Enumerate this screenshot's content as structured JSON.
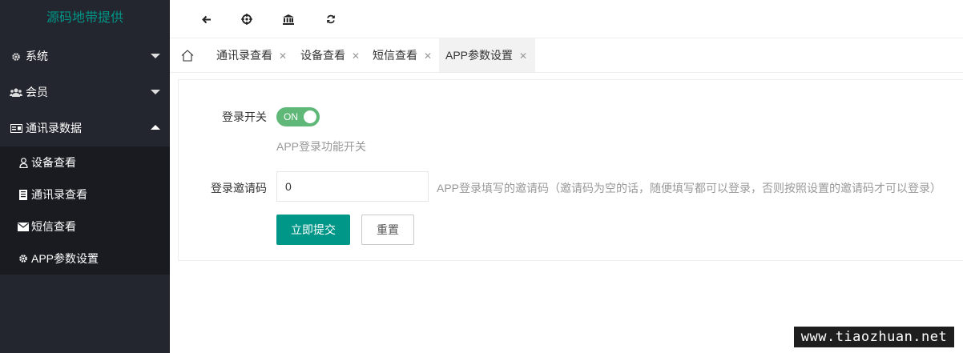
{
  "logo": "源码地带提供",
  "sidebar": {
    "items": [
      {
        "label": "系统",
        "icon": "gear-icon",
        "expanded": false
      },
      {
        "label": "会员",
        "icon": "users-icon",
        "expanded": false
      },
      {
        "label": "通讯录数据",
        "icon": "id-card-icon",
        "expanded": true
      }
    ],
    "sub_items": [
      {
        "label": "设备查看",
        "icon": "user-outline-icon"
      },
      {
        "label": "通讯录查看",
        "icon": "contacts-book-icon"
      },
      {
        "label": "短信查看",
        "icon": "envelope-icon"
      },
      {
        "label": "APP参数设置",
        "icon": "gear-icon"
      }
    ]
  },
  "toolbar": {
    "icons": [
      "back-arrow-icon",
      "crosshair-icon",
      "bank-icon",
      "refresh-icon"
    ]
  },
  "tabs": [
    {
      "label": "通讯录查看",
      "active": false
    },
    {
      "label": "设备查看",
      "active": false
    },
    {
      "label": "短信查看",
      "active": false
    },
    {
      "label": "APP参数设置",
      "active": true
    }
  ],
  "form": {
    "login_switch_label": "登录开关",
    "login_switch_state": "ON",
    "login_switch_hint": "APP登录功能开关",
    "invite_code_label": "登录邀请码",
    "invite_code_value": "0",
    "invite_code_hint": "APP登录填写的邀请码（邀请码为空的话，随便填写都可以登录，否则按照设置的邀请码才可以登录）",
    "submit_label": "立即提交",
    "reset_label": "重置"
  },
  "watermark": "www.tiaozhuan.net",
  "colors": {
    "sidebar_bg": "#23262e",
    "sub_bg": "#191b20",
    "accent": "#009688",
    "switch_on": "#5fb878"
  }
}
